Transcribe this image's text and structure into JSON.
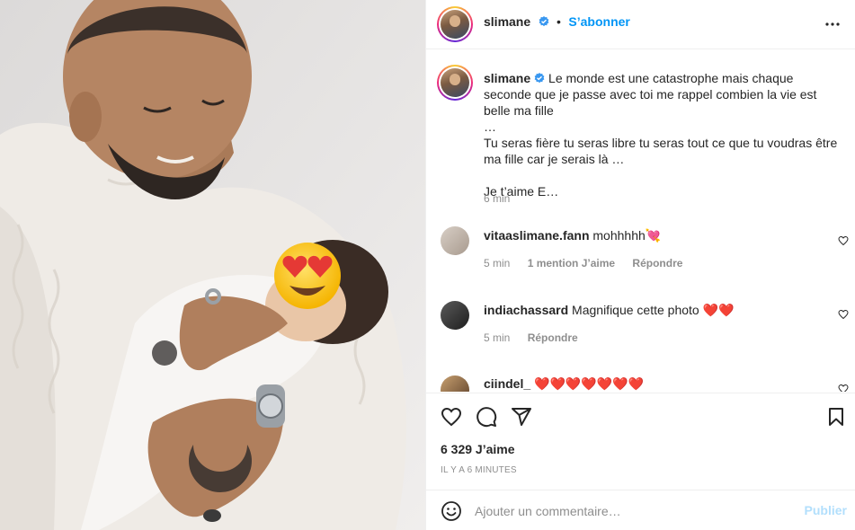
{
  "post": {
    "username": "slimane",
    "follow_label": "S’abonner",
    "separator": "•"
  },
  "caption": {
    "username": "slimane",
    "text": "Le monde est une catastrophe mais chaque seconde que je passe avec toi me rappel combien la vie est belle ma fille\n…\nTu seras fière tu seras libre tu seras tout ce que tu voudras être ma fille car je serais là …\n\nJe t’aime E…",
    "time": "6 min"
  },
  "comments": [
    {
      "username": "vitaaslimane.fann",
      "text": "mohhhhh💘",
      "time": "5 min",
      "likes": "1 mention J’aime",
      "reply": "Répondre"
    },
    {
      "username": "indiachassard",
      "text": "Magnifique cette photo ❤️❤️",
      "time": "5 min",
      "reply": "Répondre"
    },
    {
      "username": "ciindel_",
      "text": "❤️❤️❤️❤️❤️❤️❤️"
    }
  ],
  "footer": {
    "likes": "6 329 J’aime",
    "timestamp": "IL Y A 6 MINUTES"
  },
  "add_comment": {
    "placeholder": "Ajouter un commentaire…",
    "post_label": "Publier"
  },
  "icons": {
    "like": "heart-outline-icon",
    "comment": "comment-bubble-icon",
    "share": "paper-plane-icon",
    "save": "bookmark-icon",
    "more": "more-dots-icon",
    "emoji": "emoji-smiley-icon",
    "verified": "verified-badge-icon"
  },
  "colors": {
    "accent": "#0095f6",
    "verified": "#3897f0",
    "muted": "#8e8e8e",
    "post_disabled": "#b2dffc"
  }
}
